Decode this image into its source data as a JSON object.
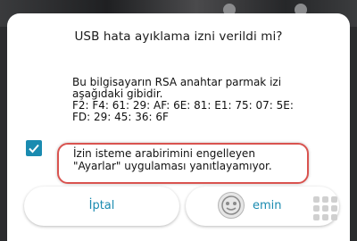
{
  "dialog": {
    "title": "USB hata ayıklama izni verildi mi?",
    "message_lines": [
      "Bu bilgisayarın RSA anahtar parmak izi",
      "aşağıdaki gibidir.",
      "F2: F4: 61: 29: AF: 6E: 81: E1: 75: 07: 5E:",
      "FD: 29: 45: 36: 6F"
    ],
    "checkbox_checked": true,
    "checkbox_label_lines": [
      "İzin isteme arabirimini engelleyen",
      "\"Ayarlar\" uygulaması yanıtlayamıyor."
    ],
    "cancel_label": "İptal",
    "confirm_label": "emin"
  },
  "colors": {
    "accent": "#1a8bb0",
    "highlight": "#d9534f"
  },
  "icons": {
    "confirm_overlay": "touch-assist-icon",
    "grid": "app-grid-icon"
  }
}
